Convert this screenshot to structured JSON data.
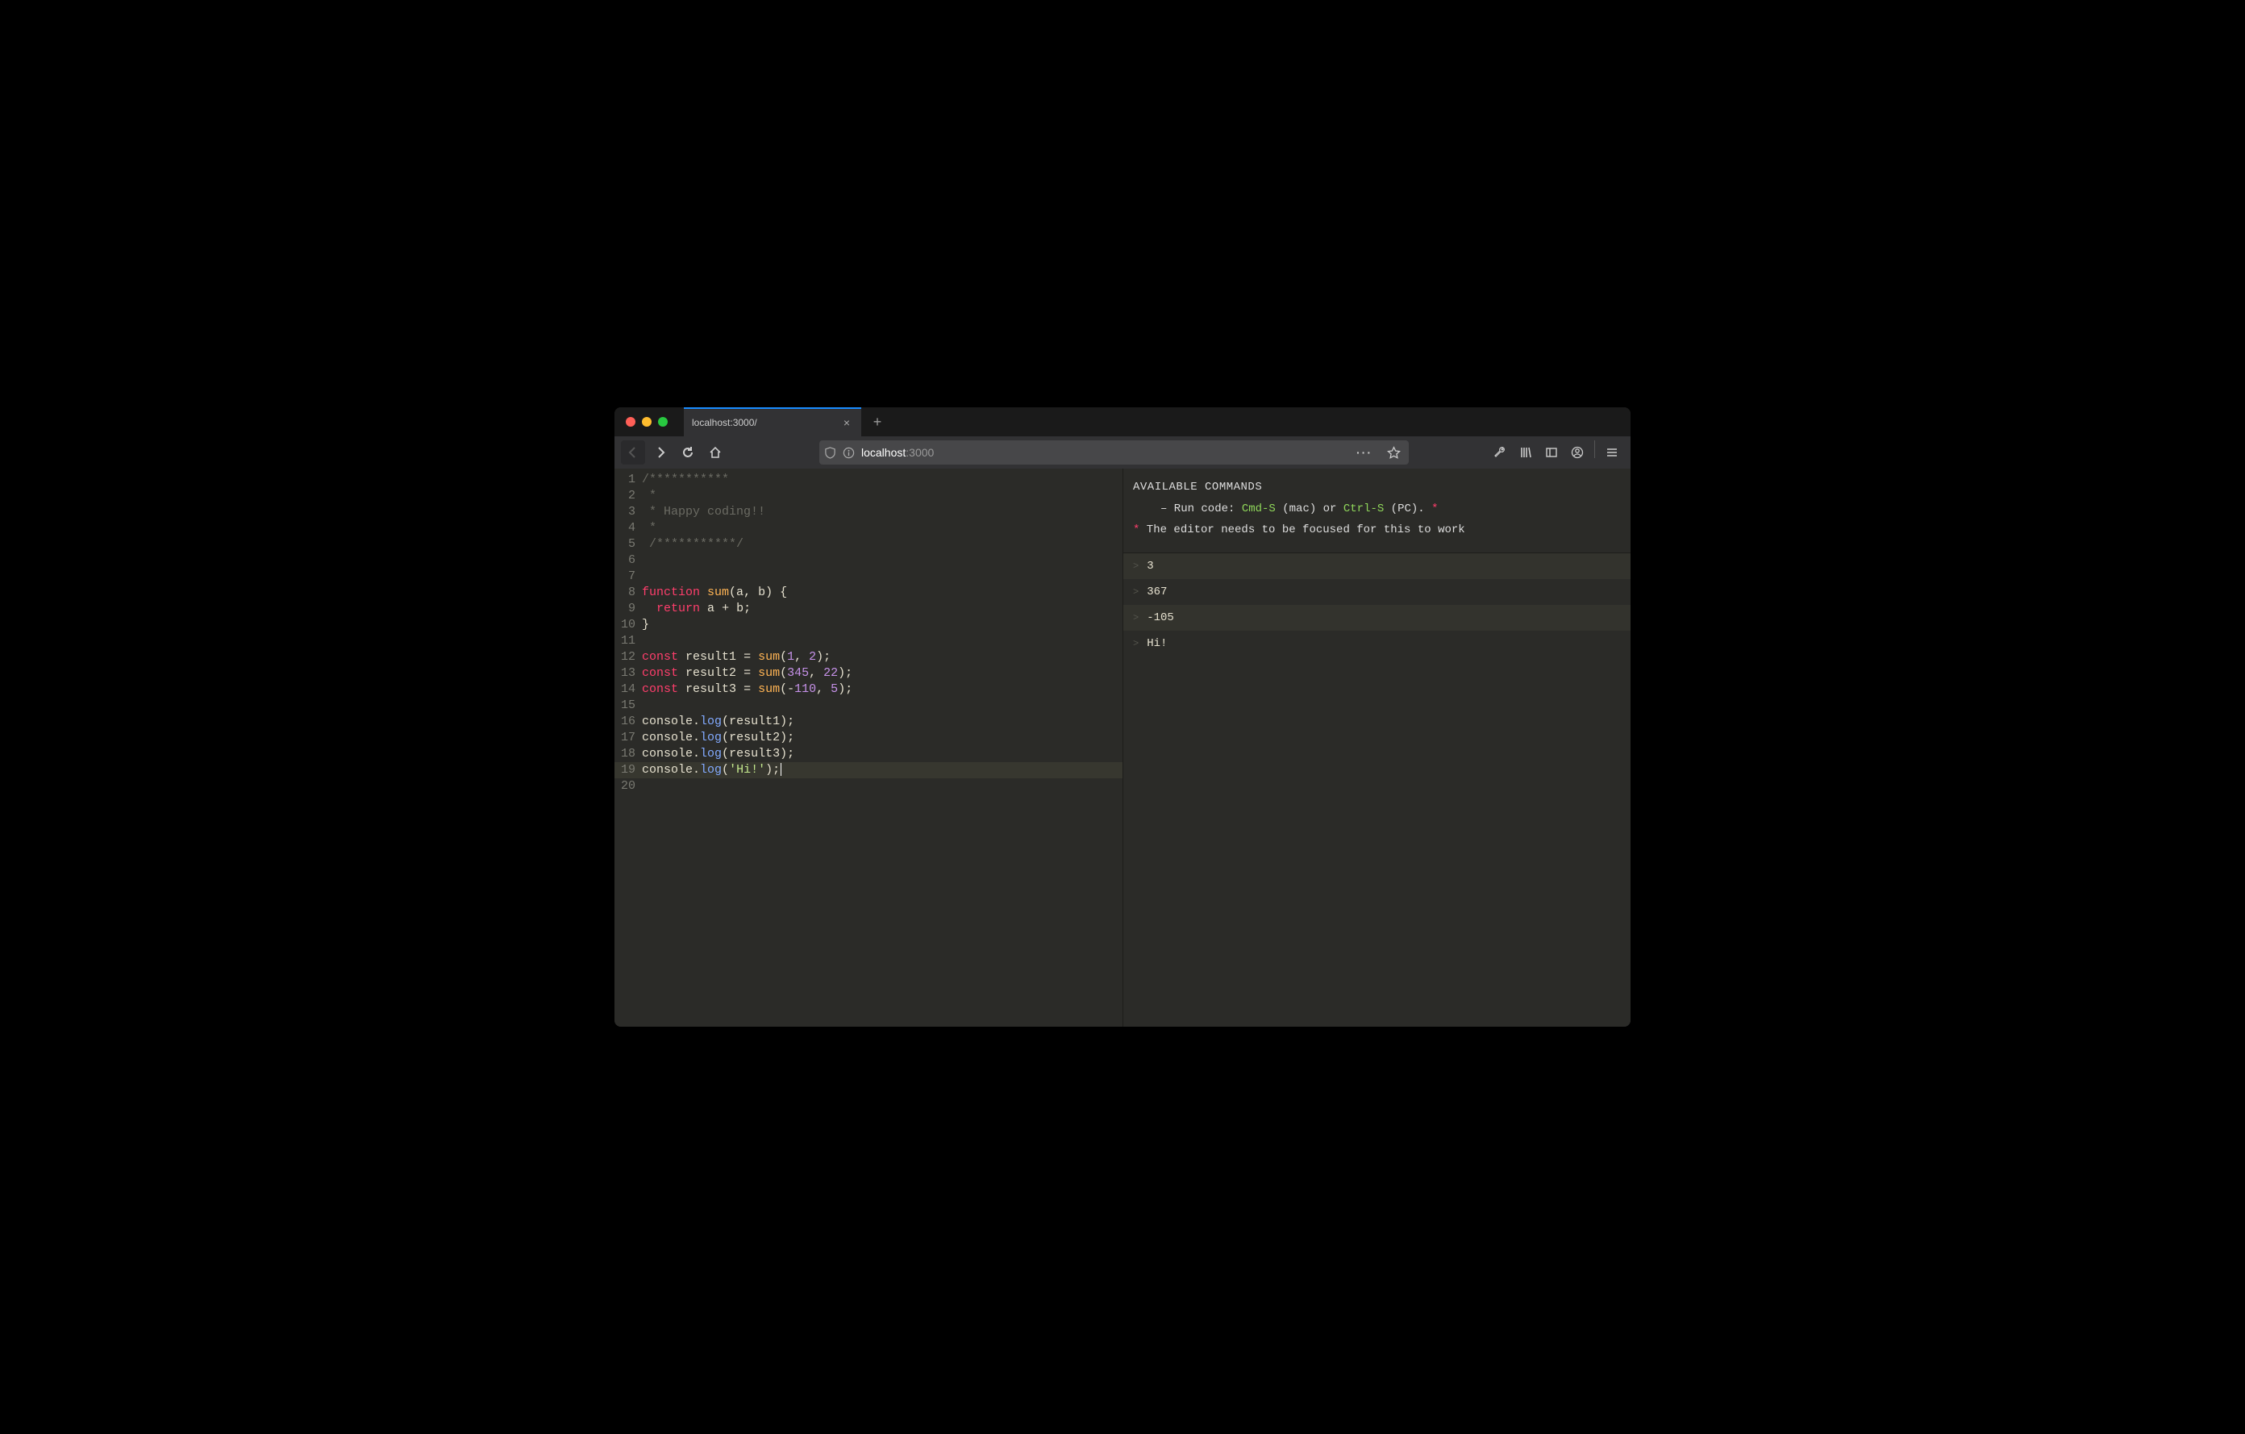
{
  "tab": {
    "title": "localhost:3000/"
  },
  "url": {
    "host": "localhost",
    "port": ":3000"
  },
  "editor": {
    "lines": [
      {
        "n": 1,
        "tokens": [
          [
            "comment",
            "/***********"
          ]
        ]
      },
      {
        "n": 2,
        "tokens": [
          [
            "comment",
            " *"
          ]
        ]
      },
      {
        "n": 3,
        "tokens": [
          [
            "comment",
            " * Happy coding!!"
          ]
        ]
      },
      {
        "n": 4,
        "tokens": [
          [
            "comment",
            " *"
          ]
        ]
      },
      {
        "n": 5,
        "tokens": [
          [
            "comment",
            " /***********/"
          ]
        ]
      },
      {
        "n": 6,
        "tokens": []
      },
      {
        "n": 7,
        "tokens": []
      },
      {
        "n": 8,
        "tokens": [
          [
            "keyword",
            "function "
          ],
          [
            "def",
            "sum"
          ],
          [
            "punct",
            "("
          ],
          [
            "var",
            "a"
          ],
          [
            "punct",
            ", "
          ],
          [
            "var",
            "b"
          ],
          [
            "punct",
            ") {"
          ]
        ]
      },
      {
        "n": 9,
        "tokens": [
          [
            "plain",
            "  "
          ],
          [
            "keyword",
            "return"
          ],
          [
            "plain",
            " "
          ],
          [
            "var",
            "a"
          ],
          [
            "plain",
            " "
          ],
          [
            "op",
            "+"
          ],
          [
            "plain",
            " "
          ],
          [
            "var",
            "b"
          ],
          [
            "punct",
            ";"
          ]
        ]
      },
      {
        "n": 10,
        "tokens": [
          [
            "punct",
            "}"
          ]
        ]
      },
      {
        "n": 11,
        "tokens": []
      },
      {
        "n": 12,
        "tokens": [
          [
            "keyword",
            "const"
          ],
          [
            "plain",
            " "
          ],
          [
            "var",
            "result1"
          ],
          [
            "plain",
            " "
          ],
          [
            "op",
            "="
          ],
          [
            "plain",
            " "
          ],
          [
            "def",
            "sum"
          ],
          [
            "punct",
            "("
          ],
          [
            "number",
            "1"
          ],
          [
            "punct",
            ", "
          ],
          [
            "number",
            "2"
          ],
          [
            "punct",
            ");"
          ]
        ]
      },
      {
        "n": 13,
        "tokens": [
          [
            "keyword",
            "const"
          ],
          [
            "plain",
            " "
          ],
          [
            "var",
            "result2"
          ],
          [
            "plain",
            " "
          ],
          [
            "op",
            "="
          ],
          [
            "plain",
            " "
          ],
          [
            "def",
            "sum"
          ],
          [
            "punct",
            "("
          ],
          [
            "number",
            "345"
          ],
          [
            "punct",
            ", "
          ],
          [
            "number",
            "22"
          ],
          [
            "punct",
            ");"
          ]
        ]
      },
      {
        "n": 14,
        "tokens": [
          [
            "keyword",
            "const"
          ],
          [
            "plain",
            " "
          ],
          [
            "var",
            "result3"
          ],
          [
            "plain",
            " "
          ],
          [
            "op",
            "="
          ],
          [
            "plain",
            " "
          ],
          [
            "def",
            "sum"
          ],
          [
            "punct",
            "("
          ],
          [
            "op",
            "-"
          ],
          [
            "number",
            "110"
          ],
          [
            "punct",
            ", "
          ],
          [
            "number",
            "5"
          ],
          [
            "punct",
            ");"
          ]
        ]
      },
      {
        "n": 15,
        "tokens": []
      },
      {
        "n": 16,
        "tokens": [
          [
            "var",
            "console"
          ],
          [
            "punct",
            "."
          ],
          [
            "prop",
            "log"
          ],
          [
            "punct",
            "("
          ],
          [
            "var",
            "result1"
          ],
          [
            "punct",
            ");"
          ]
        ]
      },
      {
        "n": 17,
        "tokens": [
          [
            "var",
            "console"
          ],
          [
            "punct",
            "."
          ],
          [
            "prop",
            "log"
          ],
          [
            "punct",
            "("
          ],
          [
            "var",
            "result2"
          ],
          [
            "punct",
            ");"
          ]
        ]
      },
      {
        "n": 18,
        "tokens": [
          [
            "var",
            "console"
          ],
          [
            "punct",
            "."
          ],
          [
            "prop",
            "log"
          ],
          [
            "punct",
            "("
          ],
          [
            "var",
            "result3"
          ],
          [
            "punct",
            ");"
          ]
        ]
      },
      {
        "n": 19,
        "tokens": [
          [
            "var",
            "console"
          ],
          [
            "punct",
            "."
          ],
          [
            "prop",
            "log"
          ],
          [
            "punct",
            "("
          ],
          [
            "string",
            "'Hi!'"
          ],
          [
            "punct",
            ");"
          ]
        ],
        "current": true,
        "cursor": true
      },
      {
        "n": 20,
        "tokens": []
      }
    ]
  },
  "help": {
    "title": "AVAILABLE COMMANDS",
    "run_prefix": "– Run code: ",
    "kbd_mac": "Cmd-S",
    "mac_suffix": " (mac) or ",
    "kbd_pc": "Ctrl-S",
    "pc_suffix": " (PC). ",
    "note": " The editor needs to be focused for this to work"
  },
  "console_output": [
    "3",
    "367",
    "-105",
    "Hi!"
  ]
}
